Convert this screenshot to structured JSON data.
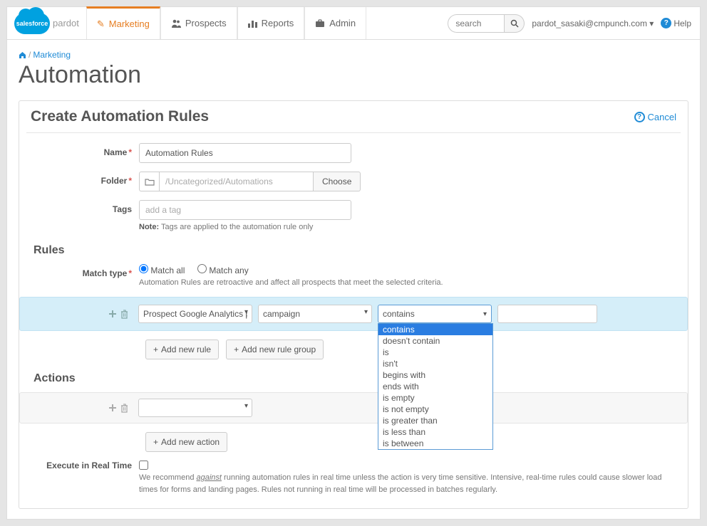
{
  "nav": {
    "brand_cloud": "salesforce",
    "brand_sub": "pardot",
    "tabs": [
      {
        "label": "Marketing",
        "icon": "pencil-icon",
        "active": true
      },
      {
        "label": "Prospects",
        "icon": "users-icon",
        "active": false
      },
      {
        "label": "Reports",
        "icon": "chart-icon",
        "active": false
      },
      {
        "label": "Admin",
        "icon": "briefcase-icon",
        "active": false
      }
    ],
    "search_placeholder": "search",
    "user": "pardot_sasaki@cmpunch.com",
    "help": "Help"
  },
  "breadcrumb": {
    "home": "🏠",
    "section": "Marketing"
  },
  "page_title": "Automation",
  "panel": {
    "title": "Create Automation Rules",
    "cancel": "Cancel"
  },
  "form": {
    "name_label": "Name",
    "name_value": "Automation Rules",
    "folder_label": "Folder",
    "folder_value": "/Uncategorized/Automations",
    "folder_choose": "Choose",
    "tags_label": "Tags",
    "tags_placeholder": "add a tag",
    "tags_note_bold": "Note:",
    "tags_note": " Tags are applied to the automation rule only"
  },
  "rules": {
    "heading": "Rules",
    "match_label": "Match type",
    "match_all": "Match all",
    "match_any": "Match any",
    "match_hint": "Automation Rules are retroactive and affect all prospects that meet the selected criteria.",
    "field_select": "Prospect Google Analytics pa",
    "param_select": "campaign",
    "operator_selected": "contains",
    "operator_options": [
      "contains",
      "doesn't contain",
      "is",
      "isn't",
      "begins with",
      "ends with",
      "is empty",
      "is not empty",
      "is greater than",
      "is less than",
      "is between"
    ],
    "value_input": "",
    "add_rule": "Add new rule",
    "add_group": "Add new rule group"
  },
  "actions": {
    "heading": "Actions",
    "add_action": "Add new action"
  },
  "execute": {
    "label": "Execute in Real Time",
    "note_pre": "We recommend ",
    "note_em": "against",
    "note_post": " running automation rules in real time unless the action is very time sensitive. Intensive, real-time rules could cause slower load times for forms and landing pages. Rules not running in real time will be processed in batches regularly."
  }
}
